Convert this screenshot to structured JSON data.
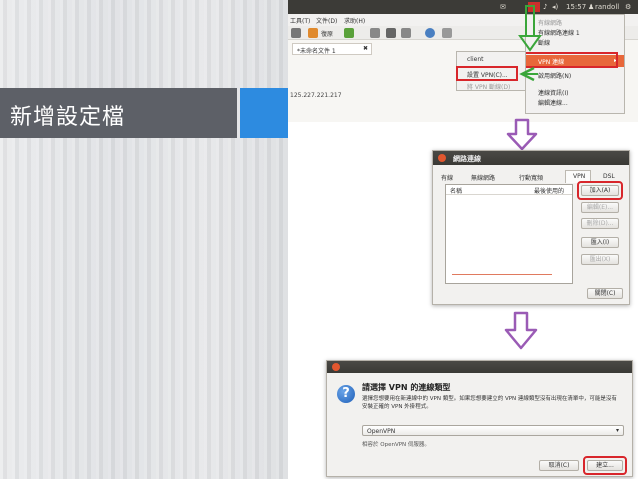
{
  "slide": {
    "title": "新增設定檔"
  },
  "colors": {
    "accent_blue": "#2d8be0",
    "title_bar": "#5d6067",
    "highlight_red": "#d8262b",
    "arrow_purple": "#9a5bb5",
    "arrow_green": "#3aa63a"
  },
  "shot1": {
    "topbar": {
      "time": "15:57",
      "user": "randoll"
    },
    "menus": [
      "工具(T)",
      "文件(D)",
      "求助(H)"
    ],
    "toolbar_restore": "復原",
    "tab_label": "*未命名文件 1",
    "ip_text": "125.227.221.217",
    "network_menu": [
      "有線網路",
      "有線網路連線 1",
      "斷線",
      "VPN 連線",
      "啟用網路(N)",
      "連線資訊(I)",
      "編輯連線..."
    ],
    "vpn_submenu": [
      "client",
      "設置 VPN(C)...",
      "將 VPN 斷線(D)"
    ]
  },
  "dialog2": {
    "title": "網路連線",
    "tabs": [
      "有線",
      "無線網路",
      "行動寬頻",
      "VPN",
      "DSL"
    ],
    "columns": [
      "名稱",
      "最後使用的"
    ],
    "buttons": [
      "加入(A)",
      "編輯(E)...",
      "刪除(D)...",
      "匯入(I)",
      "匯出(X)"
    ],
    "close": "關閉(C)"
  },
  "dialog3": {
    "heading": "請選擇 VPN 的連線類型",
    "description": "選擇您想要用在新連線中的 VPN 類型。如果您想要建立的 VPN 連線類型沒有出現在清單中，可能是沒有安裝正確的 VPN 外掛程式。",
    "selected_type": "OpenVPN",
    "compat_text": "相容於 OpenVPN 伺服器。",
    "cancel": "取消(C)",
    "create": "建立..."
  }
}
